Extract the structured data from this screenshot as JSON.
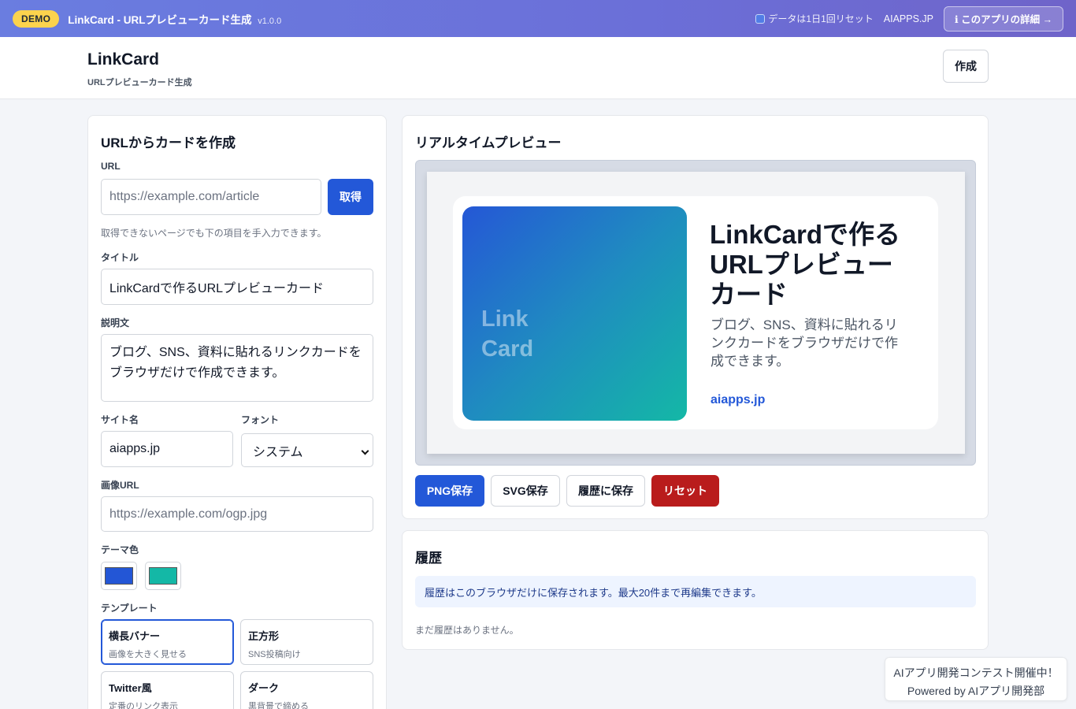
{
  "demo_bar": {
    "badge": "DEMO",
    "title": "LinkCard - URLプレビューカード生成",
    "version": "v1.0.0",
    "reset_note": "データは1日1回リセット",
    "site": "AIAPPS.JP",
    "detail_button": "ℹ このアプリの詳細 →"
  },
  "header": {
    "brand": "LinkCard",
    "subtitle": "URLプレビューカード生成",
    "create_button": "作成"
  },
  "form": {
    "title": "URLからカードを作成",
    "url_label": "URL",
    "url_placeholder": "https://example.com/article",
    "fetch_button": "取得",
    "hint": "取得できないページでも下の項目を手入力できます。",
    "title_label": "タイトル",
    "title_value": "LinkCardで作るURLプレビューカード",
    "description_label": "説明文",
    "description_value": "ブログ、SNS、資料に貼れるリンクカードをブラウザだけで作成できます。",
    "site_label": "サイト名",
    "site_value": "aiapps.jp",
    "font_label": "フォント",
    "font_value": "システム",
    "image_label": "画像URL",
    "image_placeholder": "https://example.com/ogp.jpg",
    "theme_label": "テーマ色",
    "theme_colors": [
      "#2356d6",
      "#14b8a6"
    ],
    "template_label": "テンプレート",
    "templates": [
      {
        "name": "横長バナー",
        "desc": "画像を大きく見せる",
        "active": true
      },
      {
        "name": "正方形",
        "desc": "SNS投稿向け",
        "active": false
      },
      {
        "name": "Twitter風",
        "desc": "定番のリンク表示",
        "active": false
      },
      {
        "name": "ダーク",
        "desc": "黒背景で締める",
        "active": false
      }
    ]
  },
  "preview": {
    "title": "リアルタイムプレビュー",
    "image_text": "Link Card",
    "card_title": "LinkCardで作るURLプレビューカード",
    "card_description": "ブログ、SNS、資料に貼れるリンクカードをブラウザだけで作成できます。",
    "card_site": "aiapps.jp",
    "buttons": {
      "png": "PNG保存",
      "svg": "SVG保存",
      "history": "履歴に保存",
      "reset": "リセット"
    }
  },
  "history": {
    "title": "履歴",
    "note": "履歴はこのブラウザだけに保存されます。最大20件まで再編集できます。",
    "empty": "まだ履歴はありません。"
  },
  "contest": {
    "line1": "AIアプリ開発コンテスト開催中！",
    "line2": "Powered by AIアプリ開発部"
  }
}
